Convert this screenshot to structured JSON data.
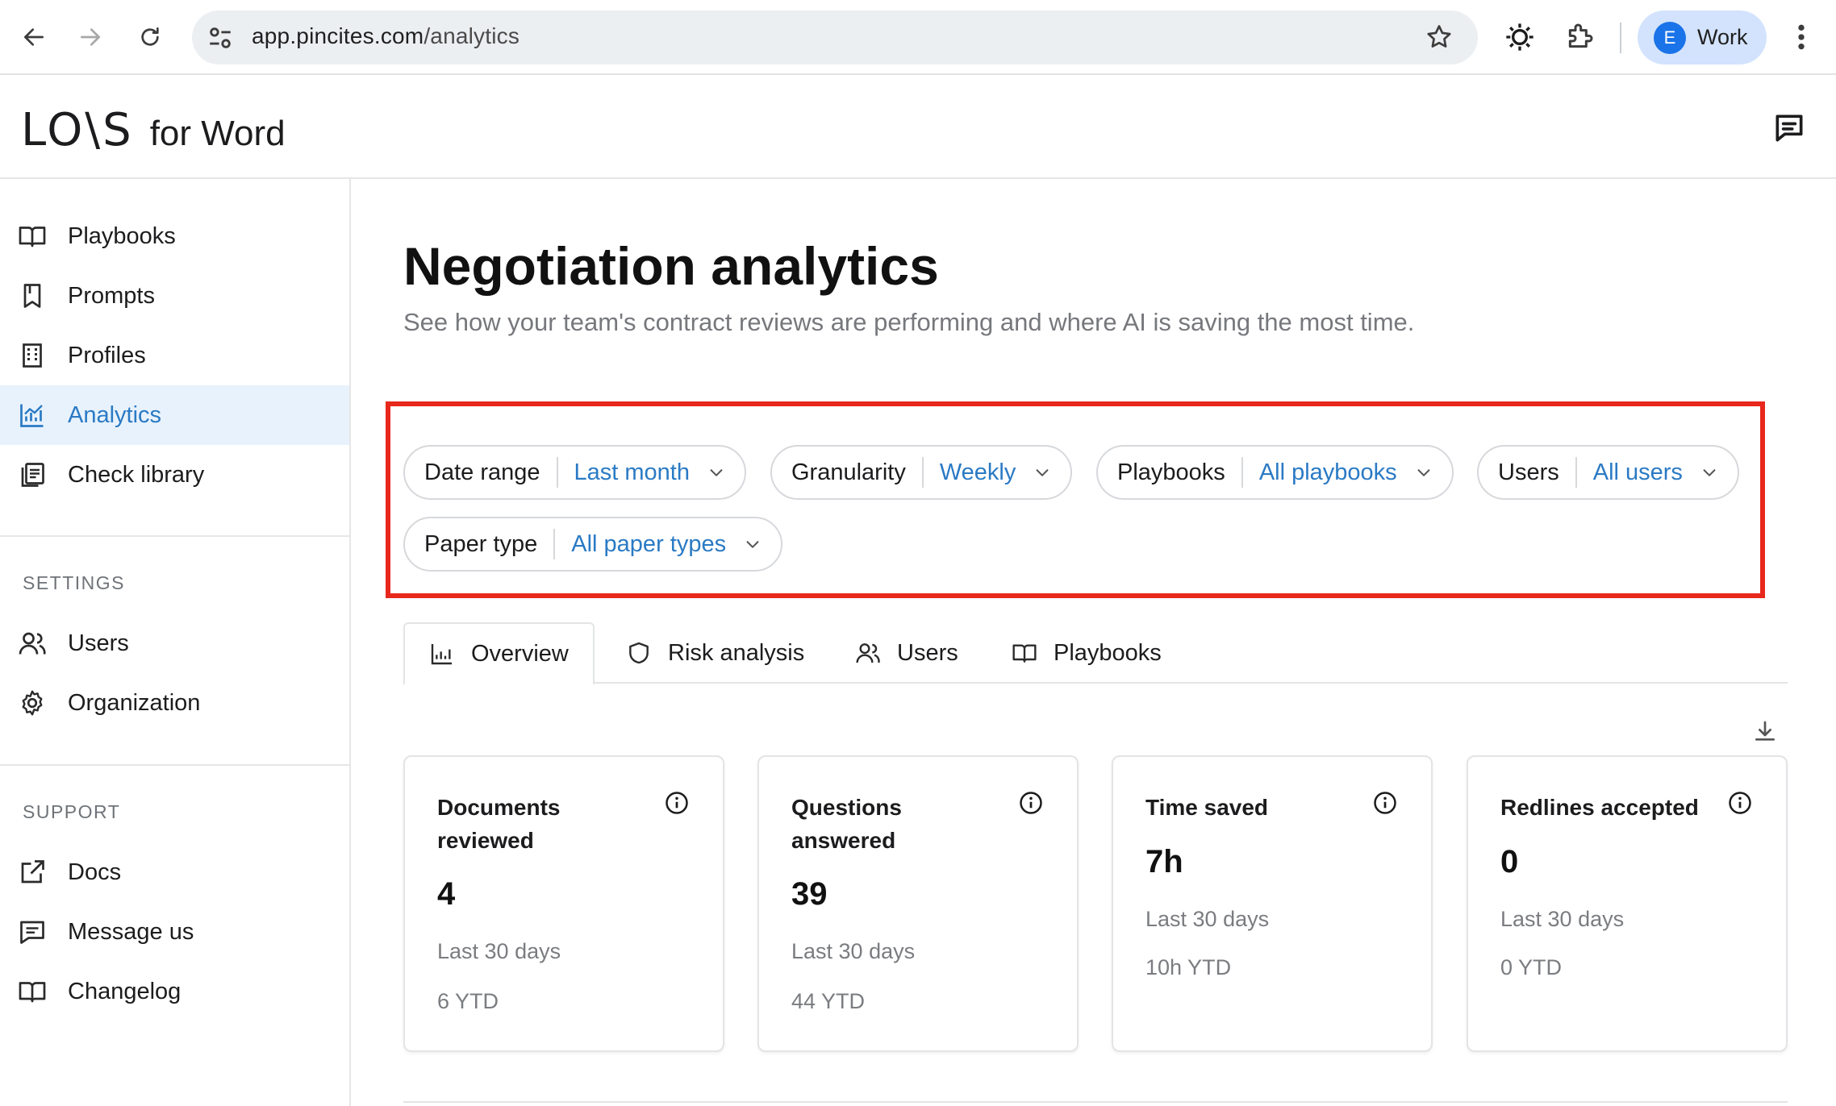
{
  "browser": {
    "url_host": "app.pincites.com",
    "url_path": "/analytics",
    "profile_initial": "E",
    "profile_name": "Work"
  },
  "app": {
    "logo_main": "LO\\S",
    "logo_sub": "for Word"
  },
  "sidebar": {
    "items": [
      {
        "label": "Playbooks",
        "icon": "book-icon"
      },
      {
        "label": "Prompts",
        "icon": "bookmark-icon"
      },
      {
        "label": "Profiles",
        "icon": "building-icon"
      },
      {
        "label": "Analytics",
        "icon": "chart-icon",
        "active": true
      },
      {
        "label": "Check library",
        "icon": "library-icon"
      }
    ],
    "settings_heading": "SETTINGS",
    "settings_items": [
      {
        "label": "Users",
        "icon": "users-icon"
      },
      {
        "label": "Organization",
        "icon": "gear-icon"
      }
    ],
    "support_heading": "SUPPORT",
    "support_items": [
      {
        "label": "Docs",
        "icon": "external-link-icon"
      },
      {
        "label": "Message us",
        "icon": "message-icon"
      },
      {
        "label": "Changelog",
        "icon": "book-icon"
      }
    ]
  },
  "main": {
    "title": "Negotiation analytics",
    "subtitle": "See how your team's contract reviews are performing and where AI is saving the most time.",
    "filters": [
      {
        "label": "Date range",
        "value": "Last month"
      },
      {
        "label": "Granularity",
        "value": "Weekly"
      },
      {
        "label": "Playbooks",
        "value": "All playbooks"
      },
      {
        "label": "Users",
        "value": "All users"
      },
      {
        "label": "Paper type",
        "value": "All paper types"
      }
    ],
    "tabs": [
      {
        "label": "Overview",
        "icon": "chart-icon",
        "active": true
      },
      {
        "label": "Risk analysis",
        "icon": "shield-icon"
      },
      {
        "label": "Users",
        "icon": "users-icon"
      },
      {
        "label": "Playbooks",
        "icon": "book-icon"
      }
    ],
    "cards": [
      {
        "title": "Documents reviewed",
        "value": "4",
        "period": "Last 30 days",
        "ytd": "6 YTD"
      },
      {
        "title": "Questions answered",
        "value": "39",
        "period": "Last 30 days",
        "ytd": "44 YTD"
      },
      {
        "title": "Time saved",
        "value": "7h",
        "period": "Last 30 days",
        "ytd": "10h YTD"
      },
      {
        "title": "Redlines accepted",
        "value": "0",
        "period": "Last 30 days",
        "ytd": "0 YTD"
      }
    ]
  },
  "colors": {
    "accent": "#2a7ac4",
    "active_bg": "#e8f2fc",
    "highlight": "#e8281c"
  }
}
